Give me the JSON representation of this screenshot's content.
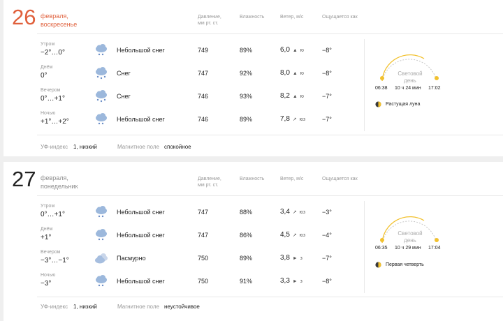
{
  "headers": {
    "pressure": "Давление, мм рт. ст.",
    "humidity": "Влажность",
    "wind": "Ветер, м/с",
    "feels": "Ощущается как"
  },
  "days": [
    {
      "day_num": "26",
      "day_line1": "февраля,",
      "day_line2": "воскресенье",
      "accent": "#e0603c",
      "rows": [
        {
          "period": "Утром",
          "temp": "−2°…0°",
          "icon": "light-snow-icon",
          "cond": "Небольшой снег",
          "pressure": "749",
          "humidity": "89%",
          "wind": "6,0",
          "dir": "ю",
          "dir_glyph": "▲",
          "feels": "−8°"
        },
        {
          "period": "Днём",
          "temp": "0°",
          "icon": "snow-icon",
          "cond": "Снег",
          "pressure": "747",
          "humidity": "92%",
          "wind": "8,0",
          "dir": "ю",
          "dir_glyph": "▲",
          "feels": "−8°"
        },
        {
          "period": "Вечером",
          "temp": "0°…+1°",
          "icon": "snow-icon",
          "cond": "Снег",
          "pressure": "746",
          "humidity": "93%",
          "wind": "8,2",
          "dir": "ю",
          "dir_glyph": "▲",
          "feels": "−7°"
        },
        {
          "period": "Ночью",
          "temp": "+1°…+2°",
          "icon": "light-snow-icon",
          "cond": "Небольшой снег",
          "pressure": "746",
          "humidity": "89%",
          "wind": "7,8",
          "dir": "юз",
          "dir_glyph": "↗",
          "feels": "−7°"
        }
      ],
      "sun": {
        "label1": "Световой",
        "label2": "день",
        "duration": "10 ч 24 мин",
        "sunrise": "06:38",
        "sunset": "17:02"
      },
      "moon": "Растущая луна",
      "uv_label": "УФ-индекс",
      "uv_value": "1, низкий",
      "mag_label": "Магнитное поле",
      "mag_value": "спокойное"
    },
    {
      "day_num": "27",
      "day_line1": "февраля,",
      "day_line2": "понедельник",
      "accent": "#222222",
      "rows": [
        {
          "period": "Утром",
          "temp": "0°…+1°",
          "icon": "light-snow-icon",
          "cond": "Небольшой снег",
          "pressure": "747",
          "humidity": "88%",
          "wind": "3,4",
          "dir": "юз",
          "dir_glyph": "↗",
          "feels": "−3°"
        },
        {
          "period": "Днём",
          "temp": "+1°",
          "icon": "light-snow-icon",
          "cond": "Небольшой снег",
          "pressure": "747",
          "humidity": "86%",
          "wind": "4,5",
          "dir": "юз",
          "dir_glyph": "↗",
          "feels": "−4°"
        },
        {
          "period": "Вечером",
          "temp": "−3°…−1°",
          "icon": "overcast-icon",
          "cond": "Пасмурно",
          "pressure": "750",
          "humidity": "89%",
          "wind": "3,8",
          "dir": "з",
          "dir_glyph": "►",
          "feels": "−7°"
        },
        {
          "period": "Ночью",
          "temp": "−3°",
          "icon": "light-snow-icon",
          "cond": "Небольшой снег",
          "pressure": "750",
          "humidity": "91%",
          "wind": "3,3",
          "dir": "з",
          "dir_glyph": "►",
          "feels": "−8°"
        }
      ],
      "sun": {
        "label1": "Световой",
        "label2": "день",
        "duration": "10 ч 29 мин",
        "sunrise": "06:35",
        "sunset": "17:04"
      },
      "moon": "Первая четверть",
      "uv_label": "УФ-индекс",
      "uv_value": "1, низкий",
      "mag_label": "Магнитное поле",
      "mag_value": "неустойчивое"
    }
  ]
}
